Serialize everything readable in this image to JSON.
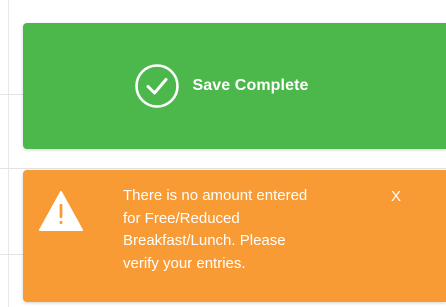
{
  "colors": {
    "success": "#4cb84c",
    "warning": "#f89b35",
    "text": "#ffffff"
  },
  "success_toast": {
    "icon": "check-circle-icon",
    "message": "Save Complete"
  },
  "warning_toast": {
    "icon": "warning-triangle-icon",
    "message_lines": [
      "There is no amount entered",
      "for Free/Reduced",
      "Breakfast/Lunch. Please",
      "verify your entries."
    ],
    "close_label": "X"
  }
}
